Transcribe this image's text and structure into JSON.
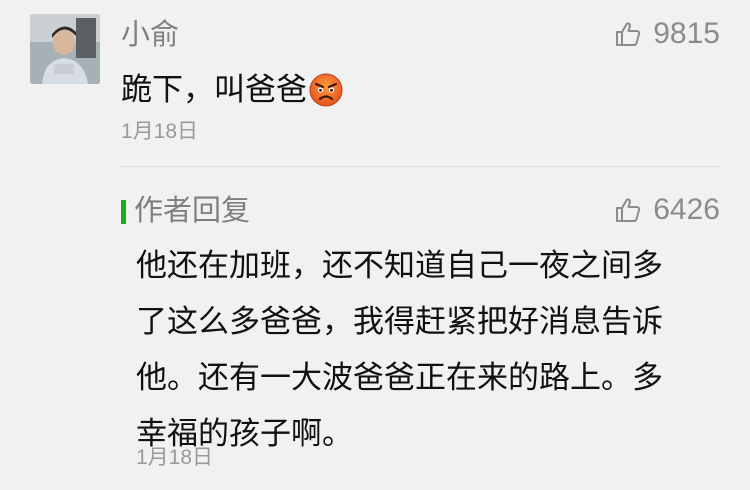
{
  "comment": {
    "author": "小俞",
    "likes": "9815",
    "text": "跪下，叫爸爸",
    "emoji": "angry-face-emoji",
    "date": "1月18日"
  },
  "author_reply": {
    "label": "作者回复",
    "likes": "6426",
    "lines": [
      "他还在加班，还不知道自己一夜之间多",
      "了这么多爸爸，我得赶紧把好消息告诉",
      "他。还有一大波爸爸正在来的路上。多",
      "幸福的孩子啊。"
    ],
    "date": "1月18日"
  },
  "colors": {
    "background": "#f1f1f1",
    "reply_accent": "#1aad19",
    "secondary_text": "#7f7f7f",
    "primary_text": "#111111"
  }
}
